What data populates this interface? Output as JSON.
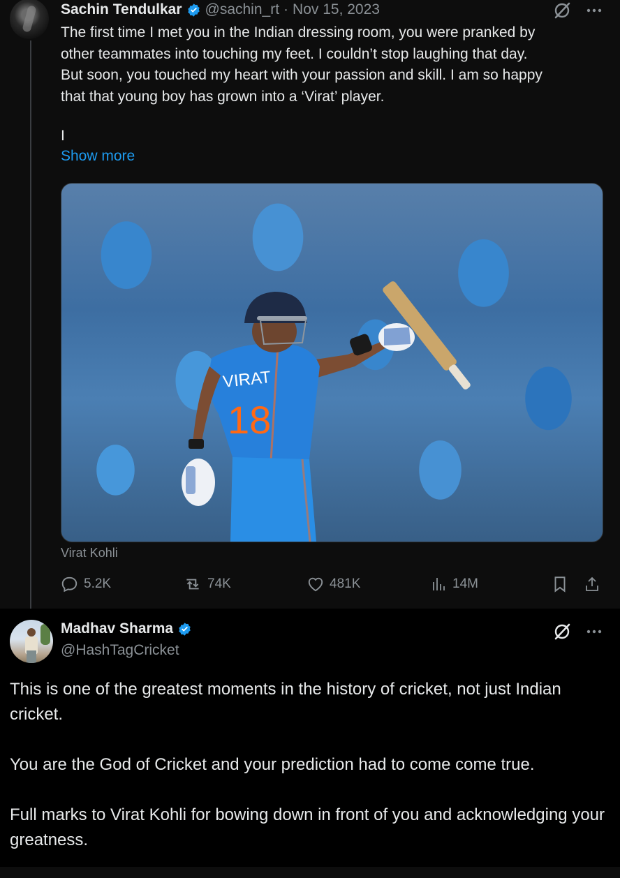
{
  "tweet1": {
    "author_name": "Sachin Tendulkar",
    "handle": "@sachin_rt",
    "separator": "·",
    "date": "Nov 15, 2023",
    "text_lines": [
      "The first time I met you in the Indian dressing room, you were pranked by",
      "other teammates into touching my feet. I couldn’t stop laughing that day.",
      "But soon, you touched my heart with your passion and skill. I am so happy",
      "that that young boy has grown into a ‘Virat’ player."
    ],
    "truncated_char": "I",
    "show_more_label": "Show more",
    "media_jersey_name": "VIRAT",
    "media_jersey_number": "18",
    "media_caption": "Virat Kohli",
    "stats": {
      "replies": "5.2K",
      "reposts": "74K",
      "likes": "481K",
      "views": "14M"
    }
  },
  "tweet2": {
    "author_name": "Madhav Sharma",
    "handle": "@HashTagCricket",
    "paragraphs": [
      "This is one of the greatest moments in the history of cricket, not just Indian cricket.",
      "You are the God of Cricket and your prediction had to come come true.",
      "Full marks to Virat Kohli for bowing down in front of you and acknowledging your greatness."
    ]
  },
  "icons": [
    "verified-badge-icon",
    "grok-icon",
    "more-icon",
    "reply-icon",
    "repost-icon",
    "like-icon",
    "views-icon",
    "bookmark-icon",
    "share-icon"
  ],
  "colors": {
    "background": "#0d0d0d",
    "reply_background": "#000000",
    "text": "#e7e9ea",
    "muted": "#8b9196",
    "link": "#1d9bf0",
    "verified": "#1d9bf0"
  }
}
